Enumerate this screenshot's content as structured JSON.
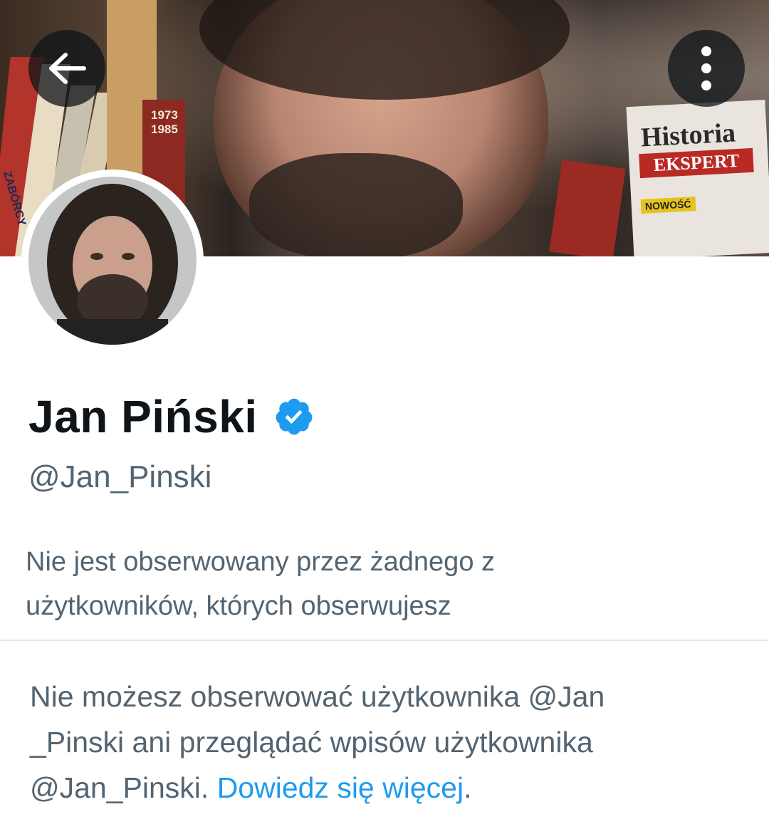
{
  "header": {
    "back_icon": "arrow-left-icon",
    "more_icon": "more-vertical-icon",
    "banner_text": {
      "magazine_title": "Historia",
      "magazine_subtitle": "EKSPERT",
      "magazine_badge": "NOWOŚĆ",
      "book_years": [
        "1973",
        "1985"
      ],
      "book_spine": "ZABÓRCY"
    }
  },
  "profile": {
    "name": "Jan Piński",
    "verified": true,
    "verified_icon": "verified-badge-icon",
    "handle": "@Jan_Pinski",
    "followers_note": "Nie jest obserwowany przez żadnego z użytkowników, których obserwujesz"
  },
  "protected_notice": {
    "text_part1": "Nie możesz obserwować użytkownika @Jan",
    "text_part2": "_Pinski ani przeglądać wpisów użytkownika",
    "text_part3": "@Jan_Pinski.",
    "link_text": "Dowiedz się więcej",
    "suffix": "."
  },
  "colors": {
    "primary_text": "#0f1419",
    "secondary_text": "#536471",
    "link": "#1d9bf0",
    "verified": "#1d9bf0"
  }
}
